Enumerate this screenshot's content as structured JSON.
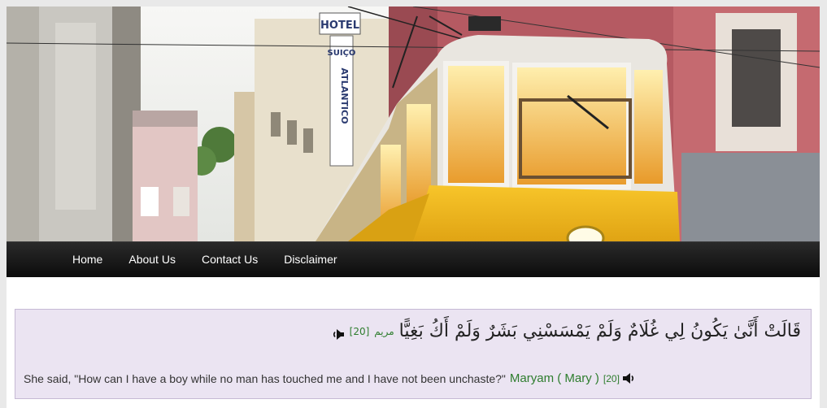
{
  "header": {
    "hotel_sign_lines": [
      "HOTEL",
      "SUIÇO",
      "ATLANTICO"
    ]
  },
  "nav": {
    "items": [
      {
        "label": "Home"
      },
      {
        "label": "About Us"
      },
      {
        "label": "Contact Us"
      },
      {
        "label": "Disclaimer"
      }
    ]
  },
  "verse": {
    "arabic_text": "قَالَتْ أَنَّىٰ يَكُونُ لِي غُلَامٌ وَلَمْ يَمْسَسْنِي بَشَرٌ وَلَمْ أَكُ بَغِيًّا",
    "arabic_surah_ref": "مريم",
    "arabic_verse_number": "[20]",
    "english_text": "She said, \"How can I have a boy while no man has touched me and I have not been unchaste?\"",
    "surah_link": "Maryam ( Mary )",
    "verse_number": "[20]",
    "audio_icon": "speaker-icon"
  },
  "colors": {
    "nav_background": "#111111",
    "verse_background": "#ebe4f2",
    "link_green": "#2e7d2e",
    "tram_yellow": "#f2b81c"
  }
}
